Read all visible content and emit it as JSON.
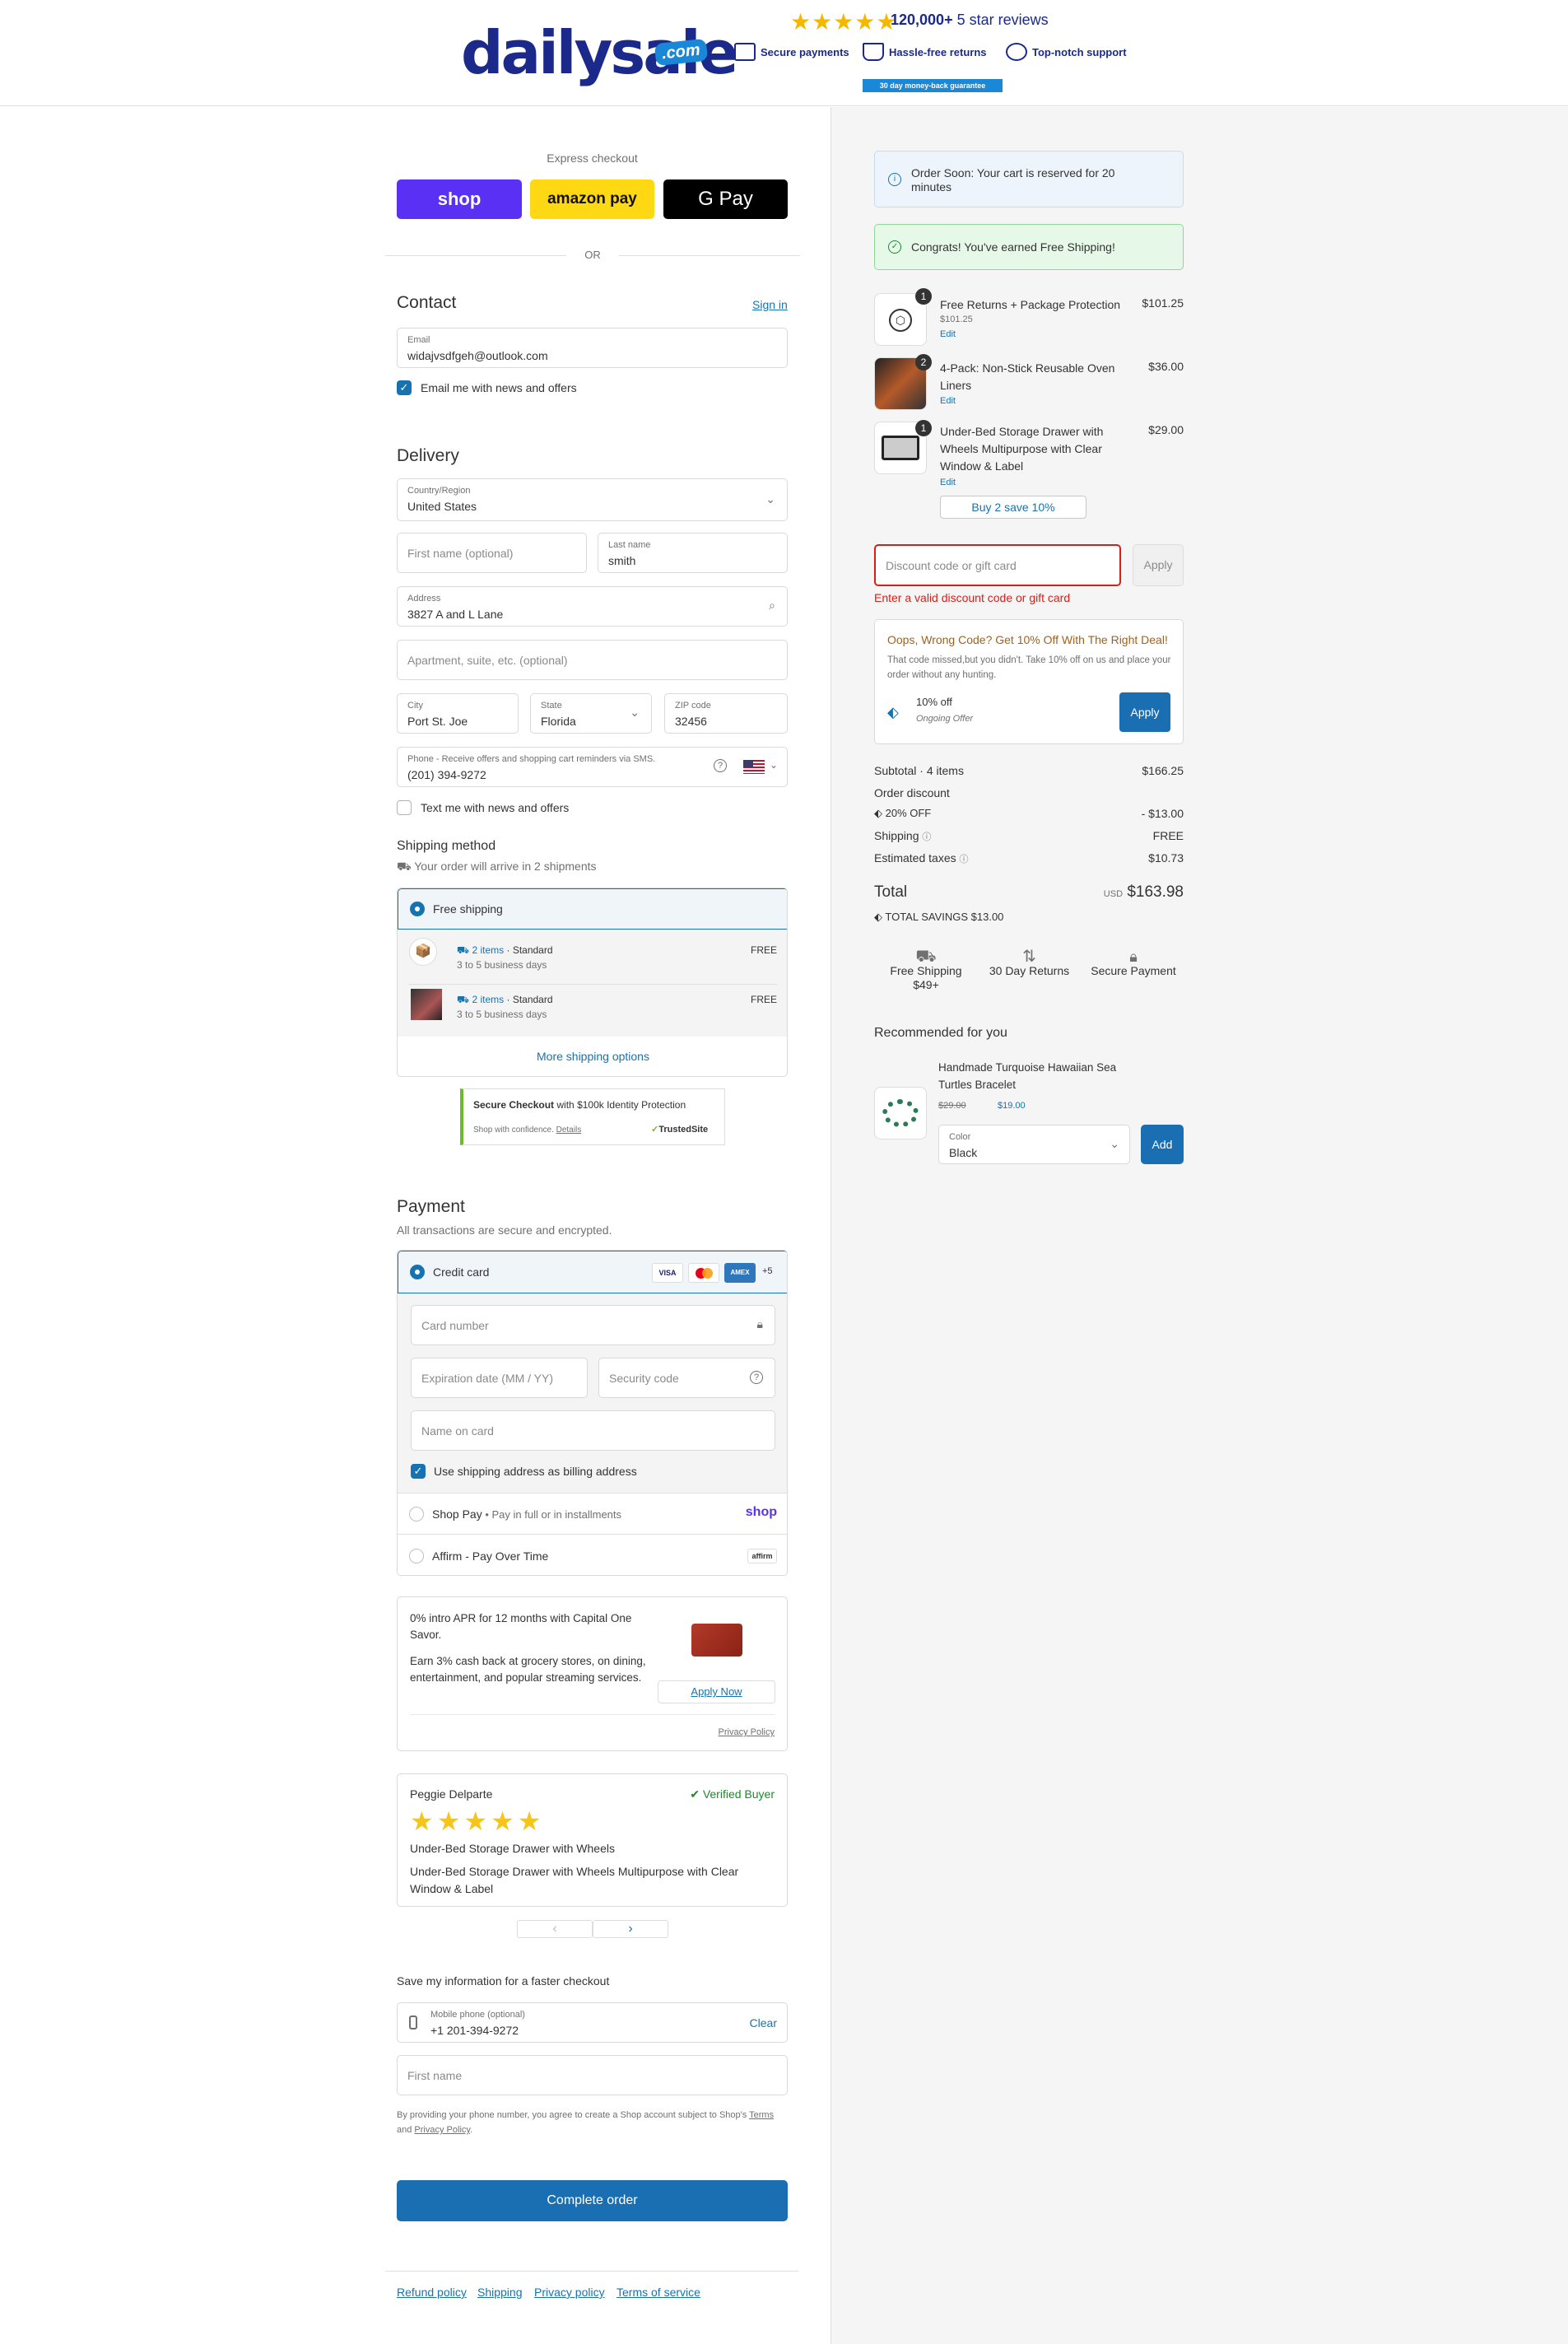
{
  "header": {
    "brand": "dailysale",
    "brand_tld": ".com",
    "stars": "★★★★★",
    "reviews_count": "120,000+",
    "reviews_text": "5 star reviews",
    "features": [
      "Secure payments",
      "Hassle-free returns",
      "Top-notch support"
    ],
    "guarantee": "30 day money-back guarantee"
  },
  "express": {
    "title": "Express checkout",
    "shop": "shop",
    "amazon": "amazon pay",
    "gpay": "G Pay",
    "or": "OR"
  },
  "contact": {
    "title": "Contact",
    "sign_in": "Sign in",
    "email_label": "Email",
    "email_value": "widajvsdfgeh@outlook.com",
    "news_label": "Email me with news and offers"
  },
  "delivery": {
    "title": "Delivery",
    "country_label": "Country/Region",
    "country_value": "United States",
    "first_name_ph": "First name (optional)",
    "last_name_label": "Last name",
    "last_name_value": "smith",
    "address_label": "Address",
    "address_value": "3827 A and L Lane",
    "apt_ph": "Apartment, suite, etc. (optional)",
    "city_label": "City",
    "city_value": "Port St. Joe",
    "state_label": "State",
    "state_value": "Florida",
    "zip_label": "ZIP code",
    "zip_value": "32456",
    "phone_label": "Phone - Receive offers and shopping cart reminders via SMS.",
    "phone_value": "(201) 394-9272",
    "sms_label": "Text me with news and offers"
  },
  "shipping": {
    "title": "Shipping method",
    "subtitle": "Your order will arrive in 2 shipments",
    "option": "Free shipping",
    "shipments": [
      {
        "items": "2 items",
        "type": "Standard",
        "days": "3 to 5 business days",
        "price": "FREE"
      },
      {
        "items": "2 items",
        "type": "Standard",
        "days": "3 to 5 business days",
        "price": "FREE"
      }
    ],
    "more": "More shipping options"
  },
  "trust": {
    "title": "Secure Checkout",
    "title2": "with $100k Identity Protection",
    "sub": "Shop with confidence.",
    "details": "Details",
    "brand": "TrustedSite"
  },
  "payment": {
    "title": "Payment",
    "subtitle": "All transactions are secure and encrypted.",
    "credit_card": "Credit card",
    "cards": [
      "VISA",
      "MC",
      "AMEX"
    ],
    "more_cards": "+5",
    "card_number_ph": "Card number",
    "exp_ph": "Expiration date (MM / YY)",
    "cvv_ph": "Security code",
    "name_ph": "Name on card",
    "billing_label": "Use shipping address as billing address",
    "shop_pay": "Shop Pay",
    "shop_pay_sub": "Pay in full or in installments",
    "shop_pay_logo": "shop",
    "affirm": "Affirm - Pay Over Time",
    "affirm_logo": "affirm"
  },
  "capital_one": {
    "line1": "0% intro APR for 12 months with Capital One Savor.",
    "line2": "Earn 3% cash back at grocery stores, on dining, entertainment, and popular streaming services.",
    "apply": "Apply Now",
    "privacy": "Privacy Policy"
  },
  "review": {
    "name": "Peggie Delparte",
    "verified": "Verified Buyer",
    "stars": 5,
    "title": "Under-Bed Storage Drawer with Wheels",
    "body": "Under-Bed Storage Drawer with Wheels Multipurpose with Clear Window & Label",
    "prev": "‹",
    "next": "›"
  },
  "save_info": {
    "title": "Save my information for a faster checkout",
    "mobile_label": "Mobile phone (optional)",
    "mobile_value": "+1 201-394-9272",
    "clear": "Clear",
    "first_name_ph": "First name",
    "terms_1": "By providing your phone number, you agree to create a Shop account subject to Shop's",
    "terms_link": "Terms",
    "terms_and": "and",
    "privacy_link": "Privacy Policy",
    "terms_end": "."
  },
  "complete": "Complete order",
  "footer_links": [
    "Refund policy",
    "Shipping",
    "Privacy policy",
    "Terms of service"
  ],
  "sidebar": {
    "reserve_notice": "Order Soon: Your cart is reserved for 20 minutes",
    "free_ship_notice": "Congrats! You've earned Free Shipping!",
    "items": [
      {
        "qty": "1",
        "name": "Free Returns + Package Protection",
        "sub": "$101.25",
        "edit": "Edit",
        "price": "$101.25"
      },
      {
        "qty": "2",
        "name": "4-Pack: Non-Stick Reusable Oven Liners",
        "edit": "Edit",
        "price": "$36.00"
      },
      {
        "qty": "1",
        "name": "Under-Bed Storage Drawer with Wheels Multipurpose with Clear Window & Label",
        "edit": "Edit",
        "price": "$29.00"
      }
    ],
    "buy2": "Buy 2 save 10%",
    "discount_ph": "Discount code or gift card",
    "apply": "Apply",
    "discount_error": "Enter a valid discount code or gift card",
    "offer_title": "Oops, Wrong Code? Get 10% Off With The Right Deal!",
    "offer_text": "That code missed,but you didn't. Take 10% off on us and place your order without any hunting.",
    "offer_name": "10% off",
    "offer_sub": "Ongoing Offer",
    "offer_apply": "Apply",
    "subtotal_label": "Subtotal · 4 items",
    "subtotal_value": "$166.25",
    "order_discount_label": "Order discount",
    "discount_code": "20% OFF",
    "discount_value": "- $13.00",
    "shipping_label": "Shipping",
    "shipping_value": "FREE",
    "taxes_label": "Estimated taxes",
    "taxes_value": "$10.73",
    "total_label": "Total",
    "currency": "USD",
    "total_value": "$163.98",
    "savings": "TOTAL SAVINGS  $13.00",
    "badges": [
      "Free Shipping $49+",
      "30 Day Returns",
      "Secure Payment"
    ],
    "rec_title": "Recommended for you",
    "rec_name": "Handmade Turquoise Hawaiian Sea Turtles Bracelet",
    "rec_old_price": "$29.00",
    "rec_price": "$19.00",
    "rec_color_label": "Color",
    "rec_color_value": "Black",
    "rec_add": "Add"
  },
  "colors": {
    "accent": "#1773b0",
    "brand": "#1b2a8a",
    "error": "#d91e18",
    "success_bg": "#e6f9e8"
  }
}
